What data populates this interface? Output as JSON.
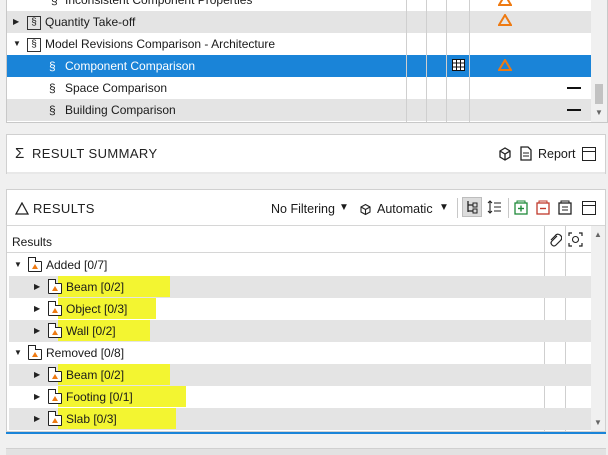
{
  "rules_tree": {
    "rows": [
      {
        "label": "Inconsistent Component Properties",
        "kind": "item"
      },
      {
        "label": "Quantity Take-off",
        "kind": "ruleset",
        "warn": true
      },
      {
        "label": "Model Revisions Comparison - Architecture",
        "kind": "ruleset-open"
      },
      {
        "label": "Component Comparison",
        "kind": "rule",
        "selected": true,
        "warn": true
      },
      {
        "label": "Space Comparison",
        "kind": "rule",
        "dash": true
      },
      {
        "label": "Building Comparison",
        "kind": "rule",
        "dash": true
      }
    ],
    "rule_symbol": "§",
    "ruleset_symbol": "§"
  },
  "summary": {
    "title": "RESULT SUMMARY",
    "title_icon": "sigma-icon",
    "report_label": "Report"
  },
  "results": {
    "title": "RESULTS",
    "title_icon": "triangle-icon",
    "filter_label": "No Filtering",
    "mode_label": "Automatic",
    "column_header": "Results",
    "rows": [
      {
        "label": "Added [0/7]",
        "level": 0,
        "expanded": true,
        "highlight": false
      },
      {
        "label": "Beam [0/2]",
        "level": 1,
        "expanded": false,
        "highlight": true
      },
      {
        "label": "Object [0/3]",
        "level": 1,
        "expanded": false,
        "highlight": true
      },
      {
        "label": "Wall [0/2]",
        "level": 1,
        "expanded": false,
        "highlight": true
      },
      {
        "label": "Removed [0/8]",
        "level": 0,
        "expanded": true,
        "highlight": false
      },
      {
        "label": "Beam [0/2]",
        "level": 1,
        "expanded": false,
        "highlight": true
      },
      {
        "label": "Footing [0/1]",
        "level": 1,
        "expanded": false,
        "highlight": true
      },
      {
        "label": "Slab [0/3]",
        "level": 1,
        "expanded": false,
        "highlight": true
      }
    ]
  },
  "colors": {
    "selection": "#1a84d8",
    "highlight": "#f3f531",
    "warning": "#ee7a12",
    "alt_row": "#e4e4e4"
  }
}
